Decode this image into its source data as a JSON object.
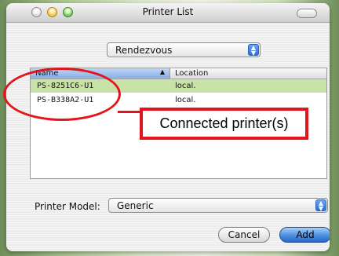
{
  "window": {
    "title": "Printer List"
  },
  "source_popup": {
    "value": "Rendezvous"
  },
  "printer_list": {
    "columns": [
      "Name",
      "Location"
    ],
    "rows": [
      {
        "name": "PS-8251C6-U1",
        "location": "local.",
        "selected": true
      },
      {
        "name": "PS-B338A2-U1",
        "location": "local.",
        "selected": false
      }
    ]
  },
  "annotation": {
    "label": "Connected printer(s)",
    "color": "#e3141b"
  },
  "printer_model": {
    "label": "Printer Model:",
    "value": "Generic"
  },
  "buttons": {
    "cancel": "Cancel",
    "add": "Add"
  }
}
